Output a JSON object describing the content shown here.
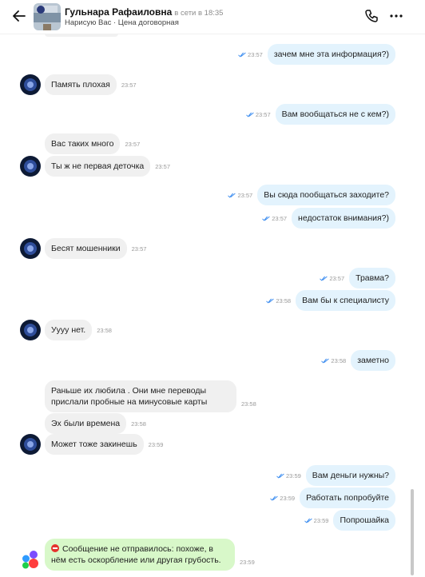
{
  "header": {
    "contact_name": "Гульнара Рафаиловна",
    "status": "в сети в 18:35",
    "subtitle": "Нарисую Вас · Цена договорная"
  },
  "messages": [
    {
      "dir": "out",
      "text": "зачем мне эта информация?)",
      "time": "23:57"
    },
    {
      "dir": "in",
      "text": "Память плохая",
      "time": "23:57"
    },
    {
      "dir": "out",
      "text": "Вам вообщаться не с кем?)",
      "time": "23:57"
    },
    {
      "dir": "in",
      "text": "Вас таких много",
      "time": "23:57"
    },
    {
      "dir": "in",
      "text": "Ты ж не первая деточка",
      "time": "23:57"
    },
    {
      "dir": "out",
      "text": "Вы сюда пообщаться заходите?",
      "time": "23:57"
    },
    {
      "dir": "out",
      "text": "недостаток внимания?)",
      "time": "23:57"
    },
    {
      "dir": "in",
      "text": "Бесят мошенники",
      "time": "23:57"
    },
    {
      "dir": "out",
      "text": "Травма?",
      "time": "23:57"
    },
    {
      "dir": "out",
      "text": "Вам бы к специалисту",
      "time": "23:58"
    },
    {
      "dir": "in",
      "text": "Уууу нет.",
      "time": "23:58"
    },
    {
      "dir": "out",
      "text": "заметно",
      "time": "23:58"
    },
    {
      "dir": "in",
      "text": "Раньше их любила . Они мне переводы прислали пробные на минусовые карты",
      "time": "23:58"
    },
    {
      "dir": "in",
      "text": "Эх были времена",
      "time": "23:58"
    },
    {
      "dir": "in",
      "text": "Может тоже закинешь",
      "time": "23:59"
    },
    {
      "dir": "out",
      "text": "Вам деньги нужны?",
      "time": "23:59"
    },
    {
      "dir": "out",
      "text": "Работать попробуйте",
      "time": "23:59"
    },
    {
      "dir": "out",
      "text": "Попрошайка",
      "time": "23:59"
    }
  ],
  "system_message": {
    "text": "Сообщение не отправилось: похоже, в нём есть оскорбление или другая грубость.",
    "time": "23:59"
  },
  "colors": {
    "incoming_bubble": "#f0f0f0",
    "outgoing_bubble": "#e3f3fd",
    "warning_bubble": "#d8f8c9",
    "read_check": "#3e8ef0",
    "warning_icon": "#e5322d"
  },
  "icons": {
    "back": "arrow-left-icon",
    "call": "phone-icon",
    "menu": "more-dots-icon",
    "read_receipt": "double-check-icon",
    "warning": "no-entry-icon",
    "app": "app-logo-icon"
  }
}
